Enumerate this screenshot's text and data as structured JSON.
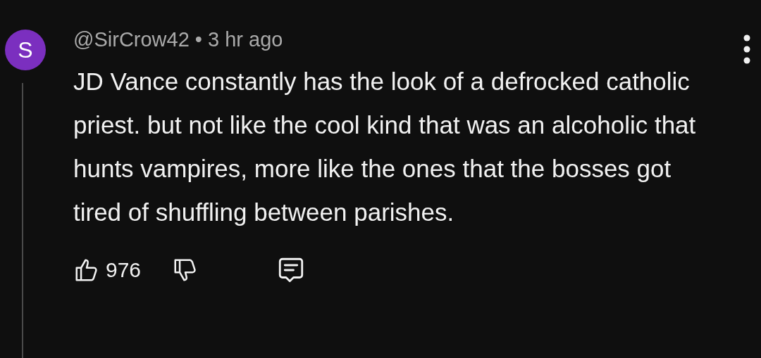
{
  "comment": {
    "avatar_letter": "S",
    "author": "@SirCrow42",
    "separator": "•",
    "time": "3 hr ago",
    "text": "JD Vance constantly has the look of a defrocked catholic priest. but not like the cool kind that was an alcoholic that hunts vampires, more like the ones that the bosses got tired of shuffling between parishes.",
    "like_count": "976"
  }
}
